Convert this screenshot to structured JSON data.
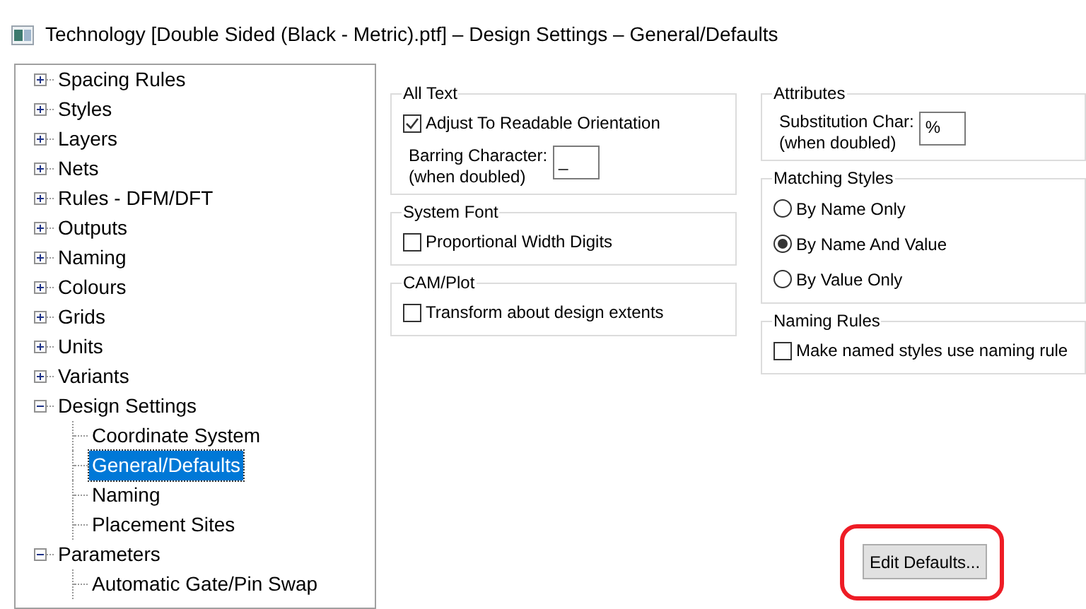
{
  "window": {
    "title": "Technology [Double Sided (Black - Metric).ptf]  – Design Settings – General/Defaults"
  },
  "tree": [
    {
      "label": "Spacing Rules",
      "expanded": false,
      "selected": false
    },
    {
      "label": "Styles",
      "expanded": false,
      "selected": false
    },
    {
      "label": "Layers",
      "expanded": false,
      "selected": false
    },
    {
      "label": "Nets",
      "expanded": false,
      "selected": false
    },
    {
      "label": "Rules - DFM/DFT",
      "expanded": false,
      "selected": false
    },
    {
      "label": "Outputs",
      "expanded": false,
      "selected": false
    },
    {
      "label": "Naming",
      "expanded": false,
      "selected": false
    },
    {
      "label": "Colours",
      "expanded": false,
      "selected": false
    },
    {
      "label": "Grids",
      "expanded": false,
      "selected": false
    },
    {
      "label": "Units",
      "expanded": false,
      "selected": false
    },
    {
      "label": "Variants",
      "expanded": false,
      "selected": false
    },
    {
      "label": "Design Settings",
      "expanded": true,
      "selected": false,
      "children": [
        {
          "label": "Coordinate System",
          "selected": false
        },
        {
          "label": "General/Defaults",
          "selected": true
        },
        {
          "label": "Naming",
          "selected": false
        },
        {
          "label": "Placement Sites",
          "selected": false
        }
      ]
    },
    {
      "label": "Parameters",
      "expanded": true,
      "selected": false,
      "children": [
        {
          "label": "Automatic Gate/Pin Swap",
          "selected": false
        }
      ]
    }
  ],
  "groups_left": [
    {
      "title": "All Text",
      "controls": [
        {
          "kind": "checkbox",
          "label": "Adjust To Readable Orientation",
          "checked": true
        },
        {
          "kind": "char_field",
          "label": "Barring Character:",
          "sublabel": "(when doubled)",
          "value": "_"
        }
      ]
    },
    {
      "title": "System Font",
      "controls": [
        {
          "kind": "checkbox",
          "label": "Proportional Width Digits",
          "checked": false
        }
      ]
    },
    {
      "title": "CAM/Plot",
      "controls": [
        {
          "kind": "checkbox",
          "label": "Transform about design extents",
          "checked": false
        }
      ]
    }
  ],
  "groups_right": [
    {
      "title": "Attributes",
      "controls": [
        {
          "kind": "char_field",
          "label": "Substitution Char:",
          "sublabel": "(when doubled)",
          "value": "%"
        }
      ]
    },
    {
      "title": "Matching Styles",
      "controls": [
        {
          "kind": "radio",
          "label": "By Name Only",
          "selected": false
        },
        {
          "kind": "radio",
          "label": "By Name And Value",
          "selected": true
        },
        {
          "kind": "radio",
          "label": "By Value Only",
          "selected": false
        }
      ]
    },
    {
      "title": "Naming Rules",
      "controls": [
        {
          "kind": "checkbox",
          "label": "Make named styles use naming rule",
          "checked": false
        }
      ]
    }
  ],
  "button": {
    "label": "Edit Defaults...",
    "highlighted": true
  }
}
